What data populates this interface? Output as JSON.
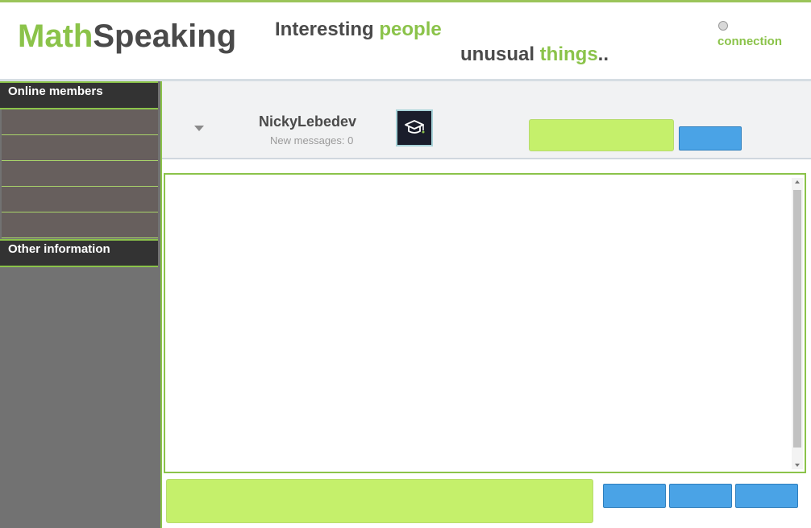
{
  "header": {
    "logo_part1": "Math",
    "logo_part2": "Speaking",
    "tagline_1a": "Interesting ",
    "tagline_1b": "people",
    "tagline_2a": "unusual ",
    "tagline_2b": "things",
    "tagline_2c": "..",
    "connection_label": "connection"
  },
  "sidebar": {
    "online_title": "Online members",
    "other_title": "Other information"
  },
  "conversation": {
    "username": "NickyLebedev",
    "new_messages": "New messages: 0"
  },
  "icons": {
    "avatar": "graduation-cap-icon",
    "dropdown": "caret-down-icon"
  },
  "colors": {
    "accent_green": "#8bc34a",
    "input_green": "#c5f06b",
    "button_blue": "#4aa3e6",
    "sidebar_dark": "#333333",
    "sidebar_gray": "#727272"
  }
}
